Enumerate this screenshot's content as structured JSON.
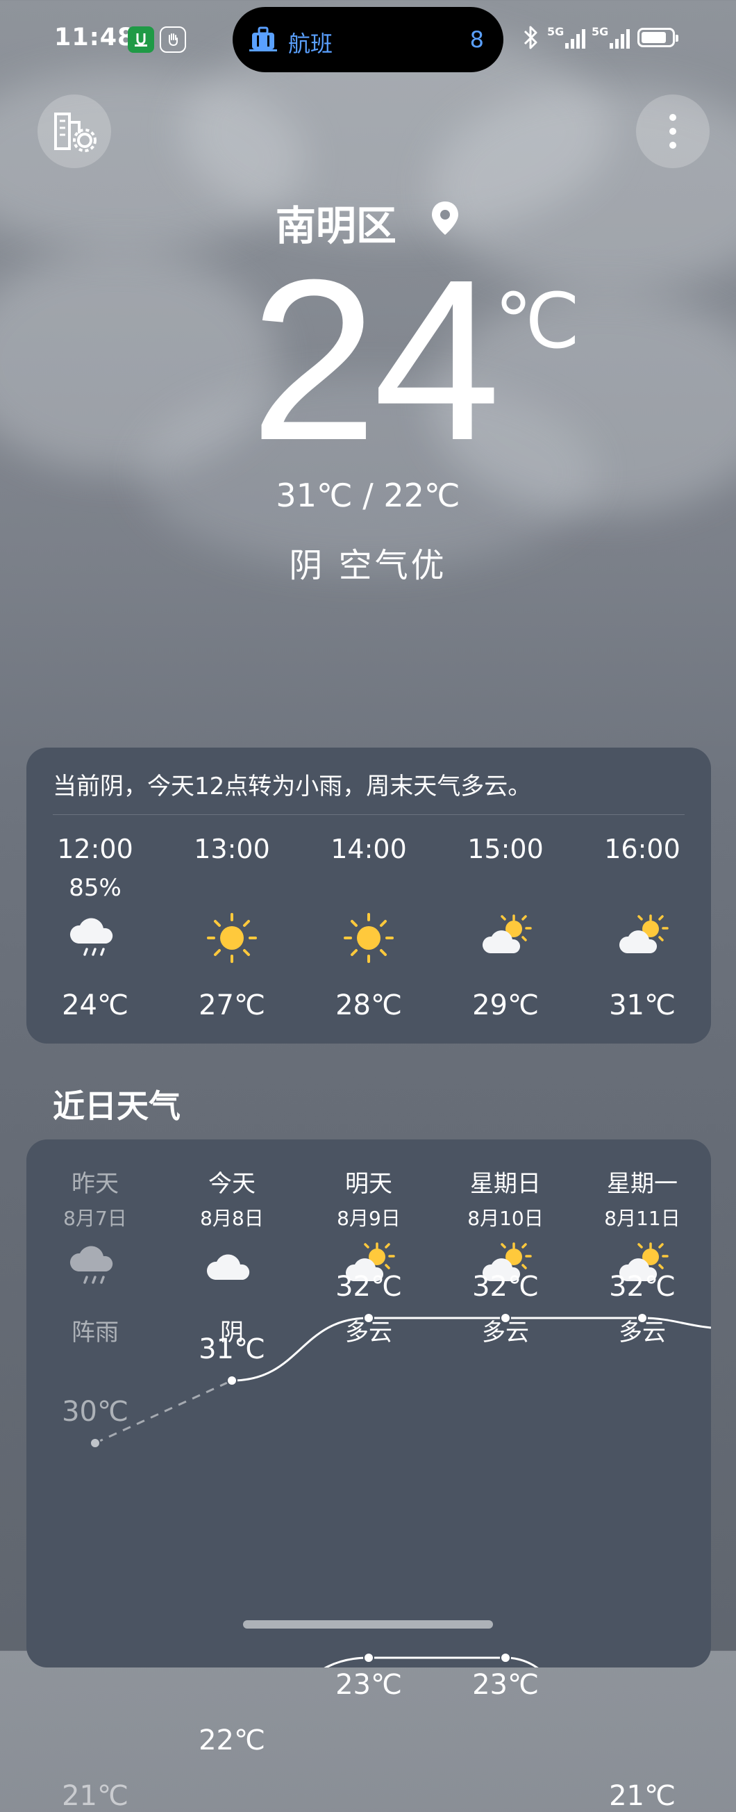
{
  "status_bar": {
    "time": "11:48",
    "island": {
      "icon": "luggage-icon",
      "label": "航班",
      "count": "8"
    },
    "signal_1": "5G",
    "signal_2": "5G",
    "battery_level": 0.8
  },
  "header": {
    "left_button_icon": "city-settings-icon",
    "right_button_icon": "more-vertical-icon"
  },
  "current": {
    "city": "南明区",
    "temperature": "24",
    "unit": "℃",
    "high_low": "31℃ / 22℃",
    "condition": "阴  空气优"
  },
  "hourly": {
    "summary": "当前阴，今天12点转为小雨，周末天气多云。",
    "items": [
      {
        "time": "12:00",
        "prob": "85%",
        "icon": "rain-icon",
        "temp": "24℃"
      },
      {
        "time": "13:00",
        "prob": "",
        "icon": "sun-icon",
        "temp": "27℃"
      },
      {
        "time": "14:00",
        "prob": "",
        "icon": "sun-icon",
        "temp": "28℃"
      },
      {
        "time": "15:00",
        "prob": "",
        "icon": "partly-cloudy-icon",
        "temp": "29℃"
      },
      {
        "time": "16:00",
        "prob": "",
        "icon": "partly-cloudy-icon",
        "temp": "31℃"
      }
    ]
  },
  "daily": {
    "title": "近日天气",
    "items": [
      {
        "day": "昨天",
        "date": "8月7日",
        "icon": "rain-icon",
        "cond": "阵雨",
        "high": "30℃",
        "low": "21℃",
        "past": true
      },
      {
        "day": "今天",
        "date": "8月8日",
        "icon": "cloudy-icon",
        "cond": "阴",
        "high": "31℃",
        "low": "22℃",
        "past": false
      },
      {
        "day": "明天",
        "date": "8月9日",
        "icon": "partly-cloudy-icon",
        "cond": "多云",
        "high": "32℃",
        "low": "23℃",
        "past": false
      },
      {
        "day": "星期日",
        "date": "8月10日",
        "icon": "partly-cloudy-icon",
        "cond": "多云",
        "high": "32℃",
        "low": "23℃",
        "past": false
      },
      {
        "day": "星期一",
        "date": "8月11日",
        "icon": "partly-cloudy-icon",
        "cond": "多云",
        "high": "32℃",
        "low": "21℃",
        "past": false
      }
    ]
  }
}
